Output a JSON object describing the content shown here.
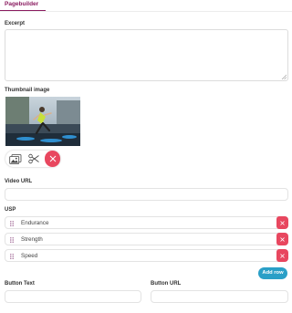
{
  "tab": {
    "label": "Pagebuilder"
  },
  "excerpt": {
    "label": "Excerpt",
    "value": ""
  },
  "thumbnail": {
    "label": "Thumbnail image"
  },
  "video": {
    "label": "Video URL",
    "value": ""
  },
  "usp": {
    "label": "USP",
    "items": [
      {
        "value": "Endurance"
      },
      {
        "value": "Strength"
      },
      {
        "value": "Speed"
      }
    ],
    "add_label": "Add row"
  },
  "button_text": {
    "label": "Button Text",
    "value": ""
  },
  "button_url": {
    "label": "Button URL",
    "value": ""
  },
  "colors": {
    "accent": "#8a1c60",
    "delete": "#e8475f",
    "primary": "#2a9fc7"
  },
  "icons": {
    "replace_image": "image-replace-icon",
    "crop": "scissors-icon",
    "remove": "close-icon",
    "drag": "drag-handle-icon"
  }
}
